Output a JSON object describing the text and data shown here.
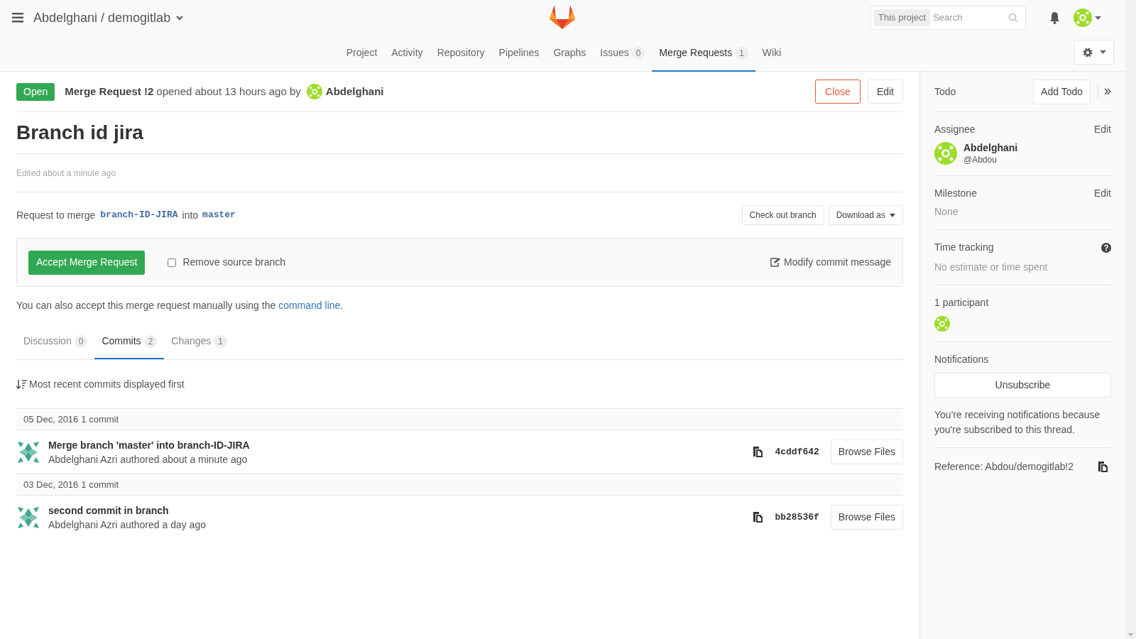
{
  "header": {
    "project_path": "Abdelghani / demogitlab",
    "search": {
      "scope": "This project",
      "placeholder": "Search"
    }
  },
  "nav": [
    {
      "label": "Project",
      "selected": false
    },
    {
      "label": "Activity",
      "selected": false
    },
    {
      "label": "Repository",
      "selected": false
    },
    {
      "label": "Pipelines",
      "selected": false
    },
    {
      "label": "Graphs",
      "selected": false
    },
    {
      "label": "Issues",
      "count": "0",
      "selected": false
    },
    {
      "label": "Merge Requests",
      "count": "1",
      "selected": true
    },
    {
      "label": "Wiki",
      "selected": false
    }
  ],
  "mr": {
    "status": "Open",
    "reference": "Merge Request !2",
    "opened": "opened about 13 hours ago by",
    "author": "Abdelghani",
    "close_button": "Close",
    "edit_button": "Edit",
    "title": "Branch id jira",
    "edited": "Edited about a minute ago"
  },
  "merge": {
    "label": "Request to merge",
    "source": "branch-ID-JIRA",
    "into": "into",
    "target": "master",
    "checkout_button": "Check out branch",
    "download_button": "Download as"
  },
  "accept": {
    "button": "Accept Merge Request",
    "remove_source": {
      "label": "Remove source branch",
      "checked": false
    },
    "modify": "Modify commit message"
  },
  "manual_note": {
    "before": "You can also accept this merge request manually using the",
    "link": "command line",
    "after": "."
  },
  "tabs": [
    {
      "label": "Discussion",
      "count": "0",
      "selected": false
    },
    {
      "label": "Commits",
      "count": "2",
      "selected": true
    },
    {
      "label": "Changes",
      "count": "1",
      "selected": false
    }
  ],
  "sort_note": "Most recent commits displayed first",
  "commit_groups": [
    {
      "date": "05 Dec, 2016",
      "count": "1 commit",
      "commits": [
        {
          "title": "Merge branch 'master' into branch-ID-JIRA",
          "author": "Abdelghani Azri",
          "authored": "authored about a minute ago",
          "sha": "4cddf642",
          "browse": "Browse Files"
        }
      ]
    },
    {
      "date": "03 Dec, 2016",
      "count": "1 commit",
      "commits": [
        {
          "title": "second commit in branch",
          "author": "Abdelghani Azri",
          "authored": "authored a day ago",
          "sha": "bb28536f",
          "browse": "Browse Files"
        }
      ]
    }
  ],
  "sidebar": {
    "todo": {
      "label": "Todo",
      "button": "Add Todo"
    },
    "assignee": {
      "label": "Assignee",
      "edit": "Edit",
      "name": "Abdelghani",
      "username": "@Abdou"
    },
    "milestone": {
      "label": "Milestone",
      "edit": "Edit",
      "value": "None"
    },
    "time_tracking": {
      "label": "Time tracking",
      "value": "No estimate or time spent"
    },
    "participants": {
      "label": "1 participant"
    },
    "notifications": {
      "label": "Notifications",
      "button": "Unsubscribe",
      "note": "You're receiving notifications because you're subscribed to this thread."
    },
    "reference": "Reference: Abdou/demogitlab!2"
  }
}
